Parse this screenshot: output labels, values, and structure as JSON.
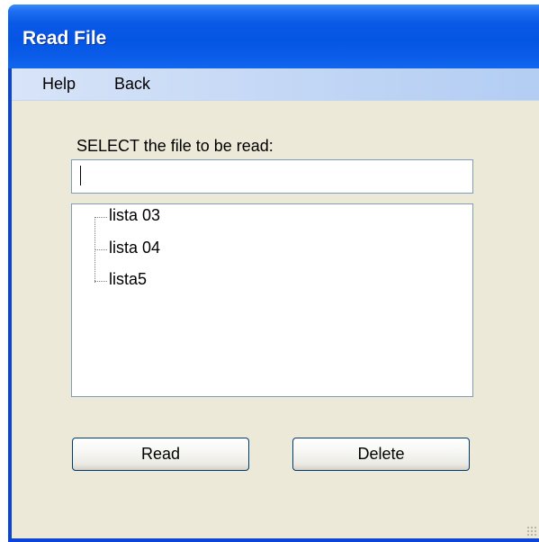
{
  "window": {
    "title": "Read File"
  },
  "menu": {
    "items": [
      "Help",
      "Back"
    ]
  },
  "form": {
    "prompt_label": "SELECT the file to be read:",
    "file_input_value": ""
  },
  "tree": {
    "items": [
      "lista 03",
      "lista 04",
      "lista5"
    ]
  },
  "buttons": {
    "read_label": "Read",
    "delete_label": "Delete"
  }
}
